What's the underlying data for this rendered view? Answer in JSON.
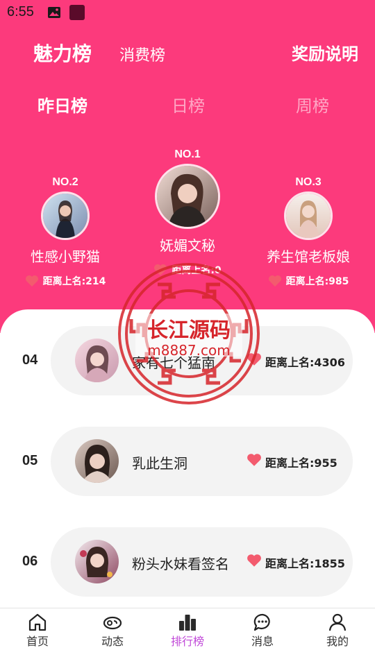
{
  "status_bar": {
    "time": "6:55",
    "icons": [
      "image-icon",
      "app-icon"
    ]
  },
  "header": {
    "tabs": [
      {
        "label": "魅力榜",
        "active": true
      },
      {
        "label": "消费榜",
        "active": false
      }
    ],
    "reward_link": "奖励说明"
  },
  "period_tabs": [
    {
      "label": "昨日榜",
      "active": true
    },
    {
      "label": "日榜",
      "active": false
    },
    {
      "label": "周榜",
      "active": false
    }
  ],
  "podium": {
    "first": {
      "rank": "NO.1",
      "name": "妩媚文秘",
      "distance": "距离上名:0"
    },
    "second": {
      "rank": "NO.2",
      "name": "性感小野猫",
      "distance": "距离上名:214"
    },
    "third": {
      "rank": "NO.3",
      "name": "养生馆老板娘",
      "distance": "距离上名:985"
    }
  },
  "list": [
    {
      "rank": "04",
      "name": "家有七个猛南",
      "distance": "距离上名:4306"
    },
    {
      "rank": "05",
      "name": "乳此生洞",
      "distance": "距离上名:955"
    },
    {
      "rank": "06",
      "name": "粉头水妹看签名",
      "distance": "距离上名:1855"
    }
  ],
  "watermark": {
    "title": "长江源码",
    "url": "m8887.com"
  },
  "bottom_nav": [
    {
      "label": "首页",
      "icon": "home-icon",
      "active": false
    },
    {
      "label": "动态",
      "icon": "moments-icon",
      "active": false
    },
    {
      "label": "排行榜",
      "icon": "ranking-icon",
      "active": true
    },
    {
      "label": "消息",
      "icon": "message-icon",
      "active": false
    },
    {
      "label": "我的",
      "icon": "profile-icon",
      "active": false
    }
  ],
  "colors": {
    "accent": "#fc3a7c",
    "heart": "#f35b6e",
    "nav_active": "#c048d8",
    "watermark": "#d6252b"
  }
}
